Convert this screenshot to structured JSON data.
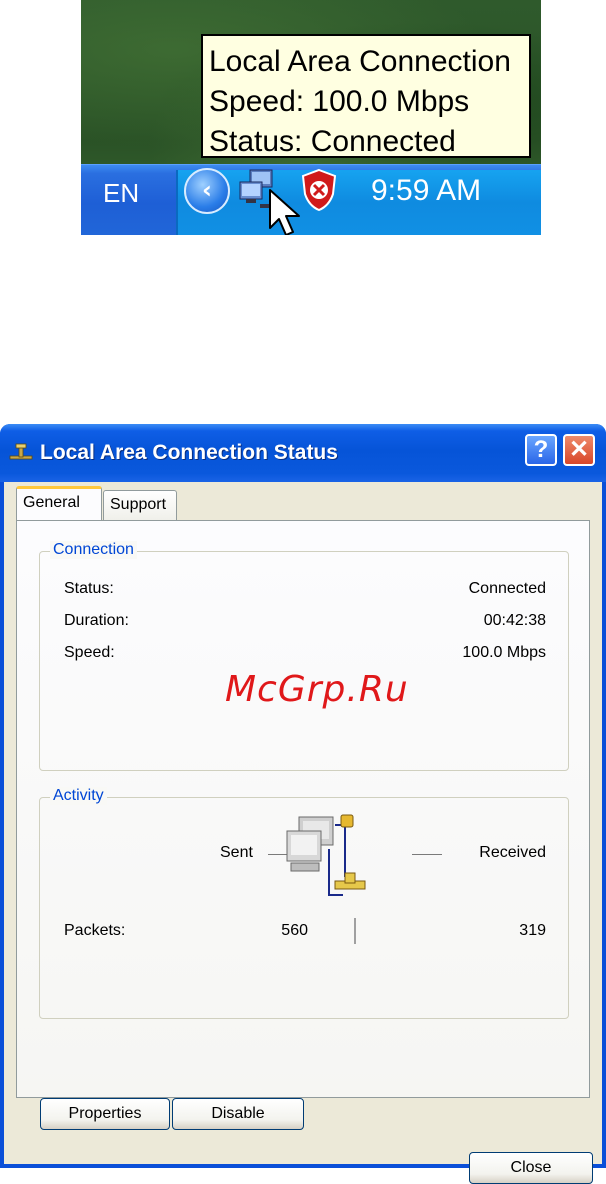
{
  "taskbar": {
    "tooltip": {
      "line1": "Local Area Connection",
      "line2": "Speed: 100.0 Mbps",
      "line3": "Status: Connected"
    },
    "language": "EN",
    "clock": "9:59 AM",
    "icons": [
      "show-hidden-icons",
      "network-connection-icon",
      "security-alert-icon",
      "mouse-cursor-icon"
    ]
  },
  "dialog": {
    "title": "Local Area Connection Status",
    "help_label": "?",
    "close_glyph": "✕",
    "tabs": [
      {
        "label": "General",
        "selected": true
      },
      {
        "label": "Support",
        "selected": false
      }
    ],
    "connection": {
      "legend": "Connection",
      "status_label": "Status:",
      "status_value": "Connected",
      "duration_label": "Duration:",
      "duration_value": "00:42:38",
      "speed_label": "Speed:",
      "speed_value": "100.0 Mbps"
    },
    "activity": {
      "legend": "Activity",
      "sent_label": "Sent",
      "received_label": "Received",
      "packets_label": "Packets:",
      "packets_sent": "560",
      "packets_received": "319"
    },
    "buttons": {
      "properties": "Properties",
      "disable": "Disable",
      "close": "Close"
    },
    "watermark": "McGrp.Ru"
  },
  "colors": {
    "titlebar": "#0654d8",
    "tray": "#0f8be0",
    "legend": "#0046d5",
    "tooltip_bg": "#ffffe1",
    "watermark": "#e0181a"
  }
}
